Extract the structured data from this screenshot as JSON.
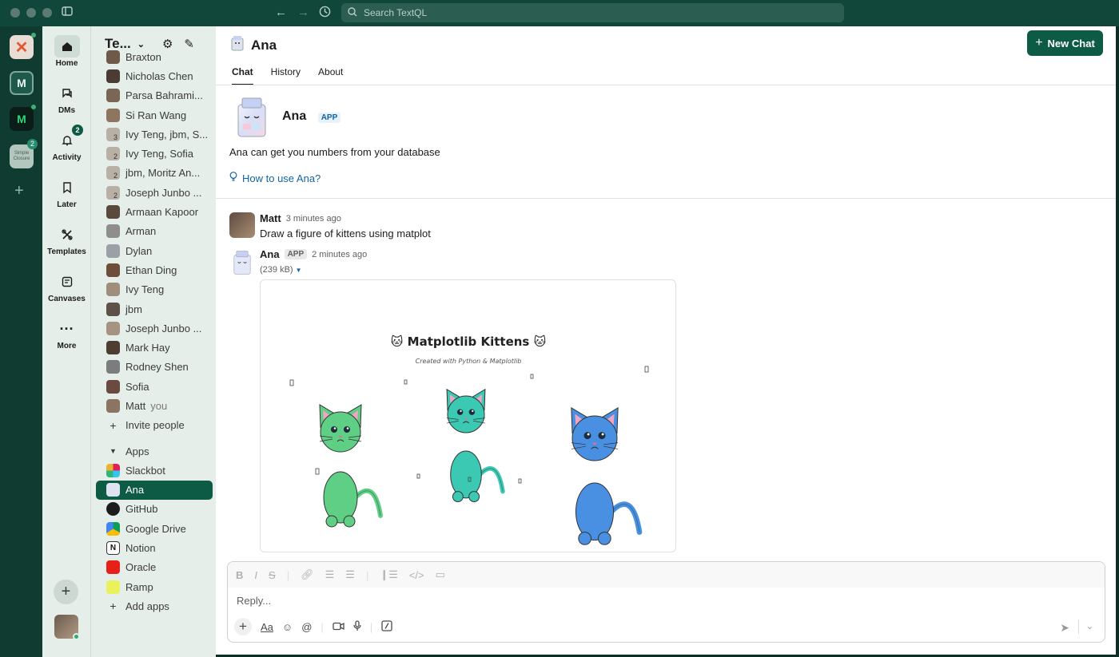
{
  "window": {
    "search_placeholder": "Search TextQL"
  },
  "workspaces": {
    "badge_count": "2",
    "simple_label": "Simple Closure"
  },
  "rail": [
    {
      "label": "Home",
      "icon": "home-icon"
    },
    {
      "label": "DMs",
      "icon": "dms-icon"
    },
    {
      "label": "Activity",
      "icon": "bell-icon",
      "badge": "2"
    },
    {
      "label": "Later",
      "icon": "bookmark-icon"
    },
    {
      "label": "Templates",
      "icon": "templates-icon"
    },
    {
      "label": "Canvases",
      "icon": "canvas-icon"
    },
    {
      "label": "More",
      "icon": "more-icon"
    }
  ],
  "sidebar": {
    "workspace_name": "Te...",
    "dms": [
      {
        "label": "Braxton"
      },
      {
        "label": "Nicholas Chen"
      },
      {
        "label": "Parsa Bahrami..."
      },
      {
        "label": "Si Ran Wang"
      },
      {
        "label": "Ivy Teng, jbm, S...",
        "count": "3"
      },
      {
        "label": "Ivy Teng, Sofia",
        "count": "2"
      },
      {
        "label": "jbm, Moritz An...",
        "count": "2"
      },
      {
        "label": "Joseph Junbo ...",
        "count": "2"
      },
      {
        "label": "Armaan Kapoor"
      },
      {
        "label": "Arman"
      },
      {
        "label": "Dylan"
      },
      {
        "label": "Ethan Ding"
      },
      {
        "label": "Ivy Teng"
      },
      {
        "label": "jbm"
      },
      {
        "label": "Joseph Junbo ..."
      },
      {
        "label": "Mark Hay"
      },
      {
        "label": "Rodney Shen"
      },
      {
        "label": "Sofia"
      }
    ],
    "self": {
      "label": "Matt",
      "suffix": "you"
    },
    "invite": "Invite people",
    "apps_header": "Apps",
    "apps": [
      {
        "label": "Slackbot"
      },
      {
        "label": "Ana"
      },
      {
        "label": "GitHub"
      },
      {
        "label": "Google Drive"
      },
      {
        "label": "Notion"
      },
      {
        "label": "Oracle"
      },
      {
        "label": "Ramp"
      }
    ],
    "add_apps": "Add apps"
  },
  "header": {
    "title": "Ana",
    "new_chat": "New Chat"
  },
  "tabs": [
    {
      "label": "Chat"
    },
    {
      "label": "History"
    },
    {
      "label": "About"
    }
  ],
  "app_intro": {
    "name": "Ana",
    "badge": "APP",
    "description": "Ana can get you numbers from your database",
    "howto": "How to use Ana?"
  },
  "messages": [
    {
      "author": "Matt",
      "time": "3 minutes ago",
      "text": "Draw a figure of kittens using matplot"
    },
    {
      "author": "Ana",
      "badge": "APP",
      "time": "2 minutes ago",
      "attachment": "(239 kB)"
    }
  ],
  "figure": {
    "title": "🐱 Matplotlib Kittens 🐱",
    "subtitle": "Created with Python & Matplotlib",
    "kitten_colors": [
      "#5fcf85",
      "#3cc9b4",
      "#4a90e2"
    ]
  },
  "composer": {
    "placeholder": "Reply..."
  }
}
